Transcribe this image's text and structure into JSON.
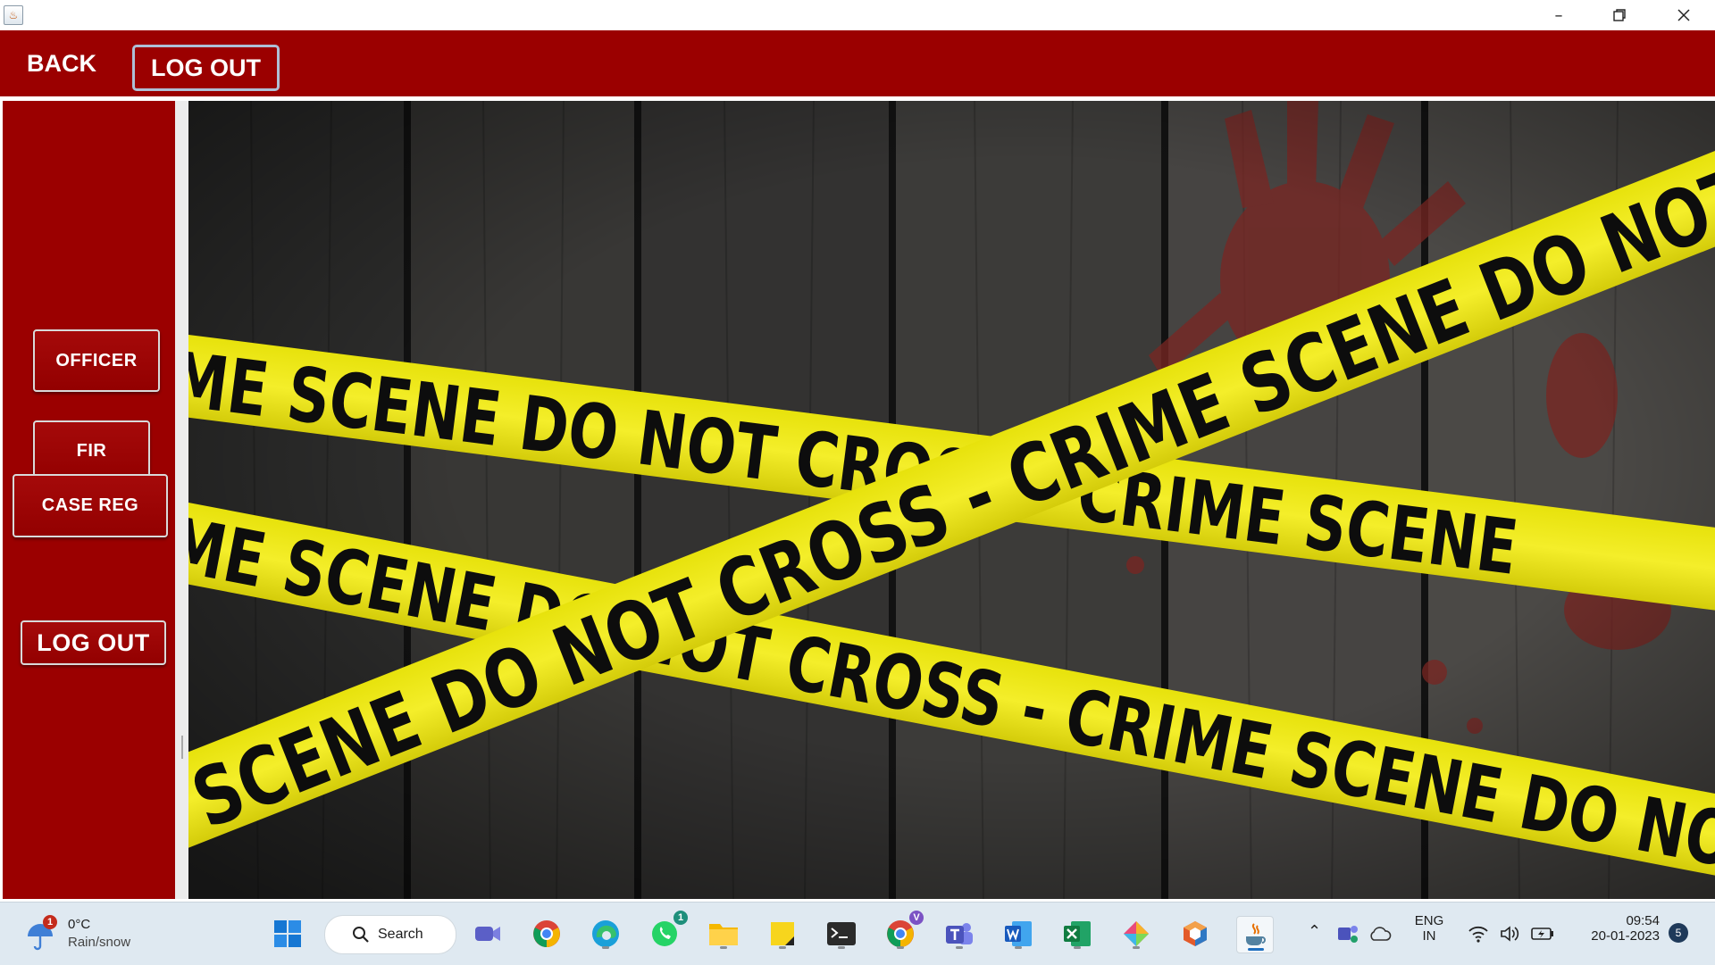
{
  "titlebar": {
    "app_icon": "java-cup-icon",
    "minimize_icon": "minimize-icon",
    "restore_icon": "restore-icon",
    "close_icon": "close-icon"
  },
  "topbar": {
    "back_label": "BACK",
    "logout_label": "LOG OUT",
    "background_color": "#9b0000"
  },
  "sidebar": {
    "officer_label": "OFFICER",
    "fir_label": "FIR",
    "case_reg_label": "CASE REG",
    "logout_label": "LOG OUT"
  },
  "scene": {
    "tape_text_upper": "ME SCENE DO NOT CROSS - CRIME SCENE",
    "tape_text_lower": "ME SCENE DO NOT CROSS - CRIME SCENE DO NOT",
    "tape_text_diagonal": "SCENE DO NOT CROSS - CRIME SCENE DO NOT",
    "tape_color": "#f2ea16"
  },
  "taskbar": {
    "weather_temp": "0°C",
    "weather_desc": "Rain/snow",
    "weather_badge": "1",
    "search_label": "Search",
    "whatsapp_badge": "1",
    "chrome_profile_badge": "V",
    "lang_line1": "ENG",
    "lang_line2": "IN",
    "time": "09:54",
    "date": "20-01-2023",
    "notification_count": "5"
  }
}
